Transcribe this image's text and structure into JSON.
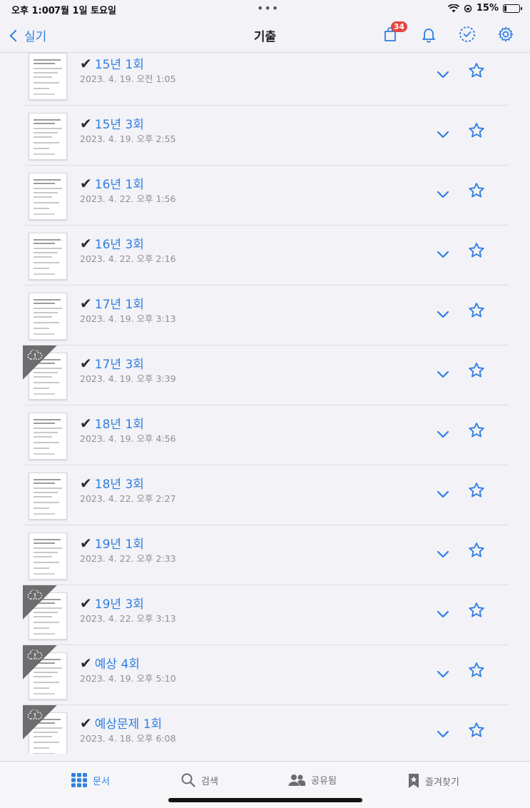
{
  "status": {
    "time": "오후 1:00",
    "date": "7월 1일 토요일",
    "dots": "•••",
    "battery": "15%",
    "battery_level": 0.15
  },
  "nav": {
    "back_label": "실기",
    "title": "기출",
    "badge_count": "34",
    "accent": "#2f7fe0"
  },
  "documents": [
    {
      "title": "15년 1회",
      "date": "2023. 4. 19. 오전 1:05",
      "cloud": false
    },
    {
      "title": "15년 3회",
      "date": "2023. 4. 19. 오후 2:55",
      "cloud": false
    },
    {
      "title": "16년 1회",
      "date": "2023. 4. 22. 오후 1:56",
      "cloud": false
    },
    {
      "title": "16년 3회",
      "date": "2023. 4. 22. 오후 2:16",
      "cloud": false
    },
    {
      "title": "17년 1회",
      "date": "2023. 4. 19. 오후 3:13",
      "cloud": false
    },
    {
      "title": "17년 3회",
      "date": "2023. 4. 19. 오후 3:39",
      "cloud": true
    },
    {
      "title": "18년 1회",
      "date": "2023. 4. 19. 오후 4:56",
      "cloud": false
    },
    {
      "title": "18년 3회",
      "date": "2023. 4. 22. 오후 2:27",
      "cloud": false
    },
    {
      "title": "19년 1회",
      "date": "2023. 4. 22. 오후 2:33",
      "cloud": false
    },
    {
      "title": "19년 3회",
      "date": "2023. 4. 22. 오후 3:13",
      "cloud": true
    },
    {
      "title": "예상 4회",
      "date": "2023. 4. 19. 오후 5:10",
      "cloud": true
    },
    {
      "title": "예상문제 1회",
      "date": "2023. 4. 18. 오후 6:08",
      "cloud": true
    }
  ],
  "check_glyph": "✔",
  "tabs": [
    {
      "label": "문서",
      "icon": "grid-icon",
      "active": true
    },
    {
      "label": "검색",
      "icon": "search-icon",
      "active": false
    },
    {
      "label": "공유됨",
      "icon": "people-icon",
      "active": false
    },
    {
      "label": "즐겨찾기",
      "icon": "bookmark-star-icon",
      "active": false
    }
  ]
}
